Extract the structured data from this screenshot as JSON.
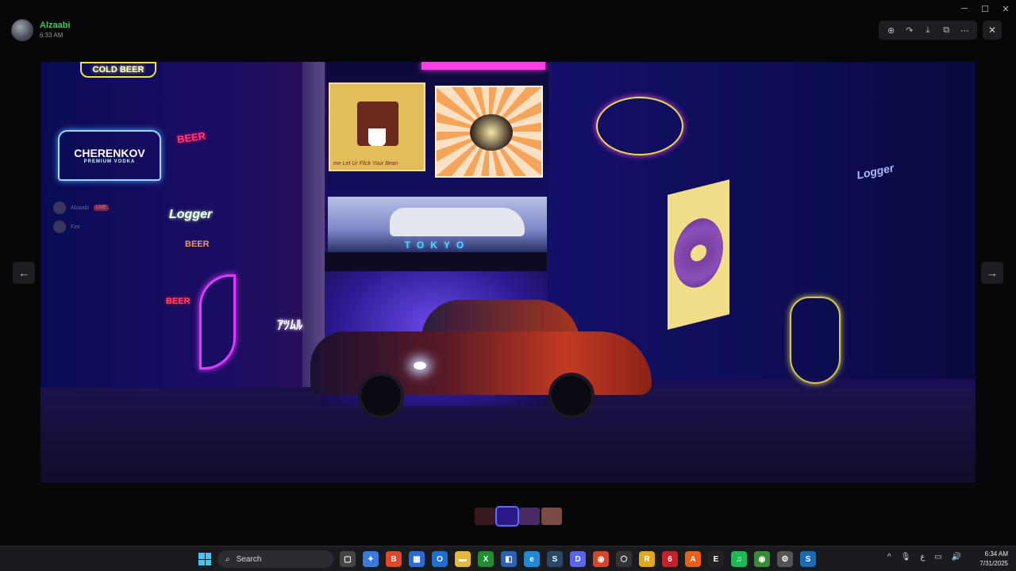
{
  "window": {
    "title": "",
    "controls": [
      "─",
      "☐",
      "✕"
    ]
  },
  "author": {
    "name": "Alzaabi",
    "time": "6:33 AM"
  },
  "toolbar": {
    "items": [
      {
        "name": "zoom-icon",
        "glyph": "⊕"
      },
      {
        "name": "forward-icon",
        "glyph": "↷"
      },
      {
        "name": "download-icon",
        "glyph": "⤓"
      },
      {
        "name": "open-external-icon",
        "glyph": "⧉"
      },
      {
        "name": "more-icon",
        "glyph": "⋯"
      }
    ],
    "close_glyph": "✕"
  },
  "image": {
    "signs": {
      "cold_beer": "COLD BEER",
      "cherenkov": "CHERENKOV",
      "cherenkov_sub": "PREMIUM VODKA",
      "beer1": "BEER",
      "logger1": "Logger",
      "beer2": "BEER",
      "beer3": "BEER",
      "logger2": "Logger",
      "tokyo": "TOKYO",
      "coffee_caption": "me Let Ur Flick Your Bean",
      "jp": "ｱﾂﾑﾙ"
    },
    "ghost_users": [
      {
        "name": "Alzaabi",
        "badge": "LIVE"
      },
      {
        "name": "Fze",
        "badge": ""
      }
    ]
  },
  "nav": {
    "prev": "←",
    "next": "→"
  },
  "thumbnails": [
    {
      "color": "#3a1820",
      "active": false
    },
    {
      "color": "#2a1a88",
      "active": true
    },
    {
      "color": "#4a2a66",
      "active": false
    },
    {
      "color": "#7a4a44",
      "active": false
    }
  ],
  "taskbar": {
    "search_label": "Search",
    "apps": [
      {
        "name": "task-view-icon",
        "glyph": "▢",
        "color": "#444"
      },
      {
        "name": "copilot-icon",
        "glyph": "✦",
        "color": "#3a7ae0"
      },
      {
        "name": "brave-icon",
        "glyph": "B",
        "color": "#e0482a"
      },
      {
        "name": "store-icon",
        "glyph": "▦",
        "color": "#2b6ad8"
      },
      {
        "name": "outlook-icon",
        "glyph": "O",
        "color": "#1f6fd0"
      },
      {
        "name": "explorer-icon",
        "glyph": "▬",
        "color": "#e8b83a"
      },
      {
        "name": "xbox-icon",
        "glyph": "X",
        "color": "#1f8f2f"
      },
      {
        "name": "app-icon",
        "glyph": "◧",
        "color": "#2a62b8"
      },
      {
        "name": "edge-icon",
        "glyph": "e",
        "color": "#1e8ad8"
      },
      {
        "name": "steam-icon",
        "glyph": "S",
        "color": "#2a4868"
      },
      {
        "name": "discord-icon",
        "glyph": "D",
        "color": "#5865f2"
      },
      {
        "name": "chrome-icon",
        "glyph": "◉",
        "color": "#d8462a"
      },
      {
        "name": "app2-icon",
        "glyph": "⬡",
        "color": "#333"
      },
      {
        "name": "rockstar-icon",
        "glyph": "R",
        "color": "#e0a81a"
      },
      {
        "name": "app3-icon",
        "glyph": "6",
        "color": "#c8202a"
      },
      {
        "name": "app4-icon",
        "glyph": "A",
        "color": "#e8601a"
      },
      {
        "name": "epic-icon",
        "glyph": "E",
        "color": "#222"
      },
      {
        "name": "spotify-icon",
        "glyph": "♫",
        "color": "#1db954"
      },
      {
        "name": "chrome2-icon",
        "glyph": "◉",
        "color": "#3a8a3a"
      },
      {
        "name": "settings-icon",
        "glyph": "⚙",
        "color": "#555"
      },
      {
        "name": "steam2-icon",
        "glyph": "S",
        "color": "#1a6ab8"
      }
    ],
    "tray": [
      "^",
      "🎙",
      "ع",
      "▭",
      "🔊"
    ],
    "time": "6:34 AM",
    "date": "7/31/2025"
  }
}
